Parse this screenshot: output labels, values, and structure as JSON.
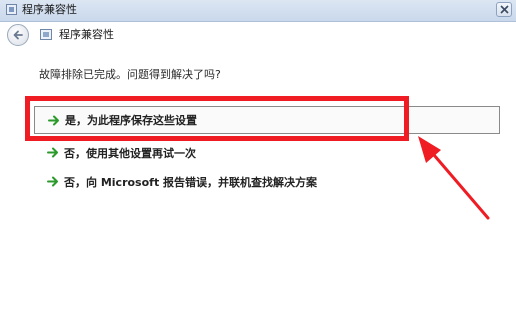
{
  "window": {
    "title": "程序兼容性",
    "close_icon": "close-icon"
  },
  "nav": {
    "back_icon": "back-arrow-icon",
    "title": "程序兼容性"
  },
  "content": {
    "question": "故障排除已完成。问题得到解决了吗?",
    "options": [
      {
        "label": "是，为此程序保存这些设置",
        "icon": "green-arrow-icon"
      },
      {
        "label": "否，使用其他设置再试一次",
        "icon": "green-arrow-icon"
      },
      {
        "label": "否，向 Microsoft 报告错误，并联机查找解决方案",
        "icon": "green-arrow-icon"
      }
    ]
  },
  "annotation": {
    "color": "#ef1c24"
  }
}
